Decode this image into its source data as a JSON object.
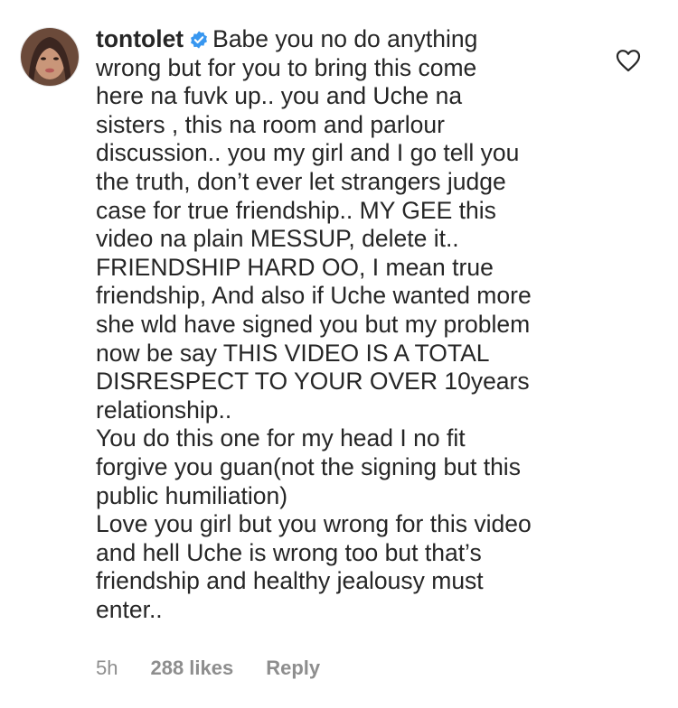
{
  "comment": {
    "username": "tontolet",
    "verified_icon": "verified-badge-icon",
    "lines": [
      "Babe you no do anything",
      "wrong but for you to bring this come",
      "here na fuvk up.. you and Uche na",
      "sisters , this na room and parlour",
      "discussion.. you my girl and I go tell you",
      "the truth, don’t ever let strangers judge",
      "case for true friendship.. MY GEE this",
      "video na plain MESSUP, delete it..",
      "FRIENDSHIP HARD OO, I mean true",
      "friendship, And also if Uche wanted more",
      "she wld have signed you but my problem",
      "now be say THIS VIDEO IS A TOTAL",
      "DISRESPECT TO YOUR OVER 10years",
      "relationship..",
      "You do this one for my head I no fit",
      "forgive you guan(not the signing but this",
      "public humiliation)",
      "Love you girl but you wrong for this video",
      "and hell Uche is wrong too but that’s",
      "friendship and healthy jealousy must",
      "enter.."
    ],
    "time": "5h",
    "likes": "288 likes",
    "reply_label": "Reply",
    "like_icon": "heart-outline-icon",
    "colors": {
      "text": "#262626",
      "meta": "#8e8e8e",
      "verified": "#3897f0"
    }
  }
}
